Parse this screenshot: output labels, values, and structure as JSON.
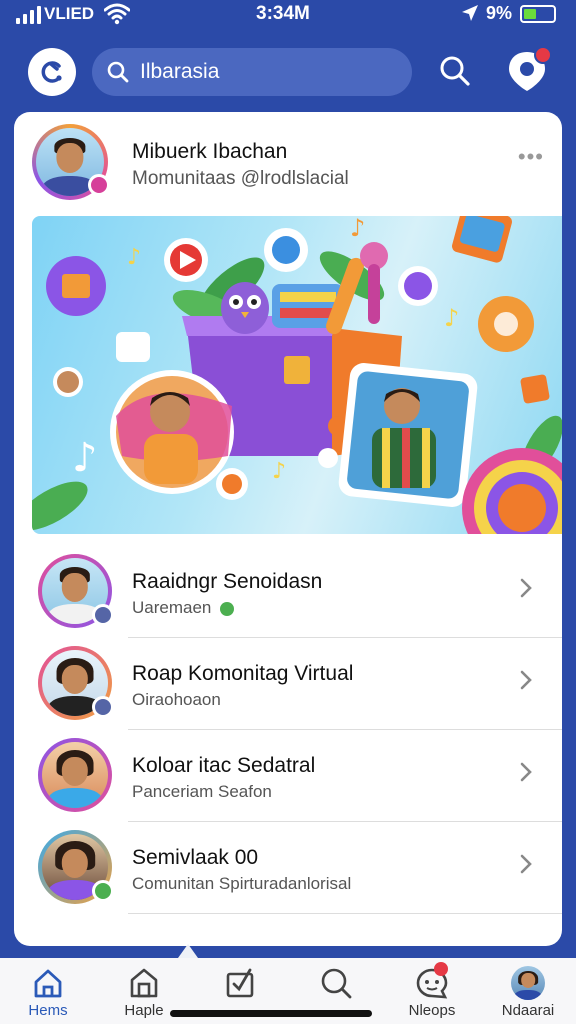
{
  "status_bar": {
    "carrier": "VLIED",
    "time": "3:34M",
    "battery_pct": "9%"
  },
  "header": {
    "search_text": "Ilbarasia",
    "logo_icon": "app-logo-icon",
    "notify_icon": "notification-icon"
  },
  "post": {
    "name": "Mibuerk Ibachan",
    "handle": "Momunitaas @lrodlslacial",
    "more": "•••"
  },
  "list": [
    {
      "title": "Raaidngr Senoidasn",
      "sub": "Uaremaen",
      "badge": "#4caf50",
      "ring": [
        "#e14f9a",
        "#8b55e6"
      ],
      "bg": [
        "#c7e6f6",
        "#8cc6e5"
      ]
    },
    {
      "title": "Roap Komonitag Virtual",
      "sub": "Oiraohoaon",
      "badge": "#5565a6",
      "ring": [
        "#e14f9a",
        "#f0a040"
      ],
      "bg": [
        "#eaf4fb",
        "#c4d9ea"
      ]
    },
    {
      "title": "Koloar itac Sedatral",
      "sub": "Panceriam Seafon",
      "badge": "#8b55e6",
      "ring": [
        "#8b55e6",
        "#e14f9a"
      ],
      "bg": [
        "#f3d0a8",
        "#d98a5a"
      ]
    },
    {
      "title": "Semivlaak 00",
      "sub": "Comunitan Spirturadanlorisal",
      "badge": "#4caf50",
      "ring": [
        "#3aa9e8",
        "#f0a040"
      ],
      "bg": [
        "#e0c7a3",
        "#6a4a3a"
      ]
    }
  ],
  "bottom_nav": [
    {
      "label": "Hems",
      "icon": "home-icon",
      "active": true
    },
    {
      "label": "Haple",
      "icon": "store-icon",
      "active": false
    },
    {
      "label": "",
      "icon": "checkbox-icon",
      "active": false
    },
    {
      "label": "",
      "icon": "search-icon",
      "active": false
    },
    {
      "label": "Nleops",
      "icon": "chat-icon",
      "active": false
    },
    {
      "label": "Ndaarai",
      "icon": "profile-icon",
      "active": false
    }
  ]
}
